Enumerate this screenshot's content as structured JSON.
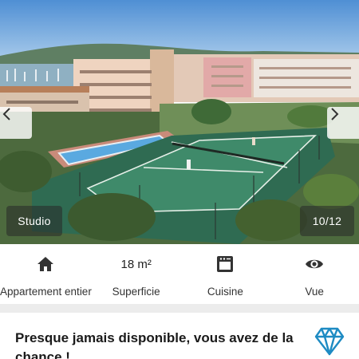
{
  "gallery": {
    "property_type": "Studio",
    "counter": "10/12",
    "prev_icon": "chevron-left-icon",
    "next_icon": "chevron-right-icon"
  },
  "amenities": [
    {
      "icon": "home-icon",
      "value": "",
      "label": "Appartement entier"
    },
    {
      "icon": "area-icon",
      "value": "18 m²",
      "label": "Superficie"
    },
    {
      "icon": "oven-icon",
      "value": "",
      "label": "Cuisine"
    },
    {
      "icon": "eye-icon",
      "value": "",
      "label": "Vue"
    }
  ],
  "notice": {
    "text": "Presque jamais disponible, vous avez de la chance !",
    "icon": "diamond-icon",
    "accent_color": "#1e8bc3"
  }
}
